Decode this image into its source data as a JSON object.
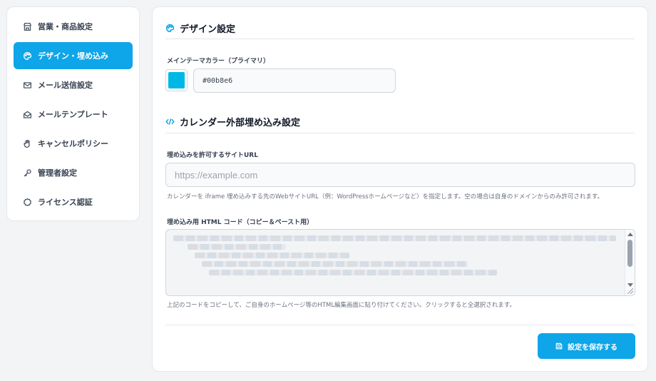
{
  "sidebar": {
    "items": [
      {
        "label": "営業・商品設定",
        "icon": "store-icon",
        "active": false
      },
      {
        "label": "デザイン・埋め込み",
        "icon": "palette-icon",
        "active": true
      },
      {
        "label": "メール送信設定",
        "icon": "mail-icon",
        "active": false
      },
      {
        "label": "メールテンプレート",
        "icon": "mail-open-icon",
        "active": false
      },
      {
        "label": "キャンセルポリシー",
        "icon": "hand-icon",
        "active": false
      },
      {
        "label": "管理者設定",
        "icon": "key-icon",
        "active": false
      },
      {
        "label": "ライセンス認証",
        "icon": "badge-icon",
        "active": false
      }
    ]
  },
  "design": {
    "title": "デザイン設定",
    "color_label": "メインテーマカラー（プライマリ）",
    "color_value": "#00b8e6"
  },
  "embed": {
    "title": "カレンダー外部埋め込み設定",
    "url_label": "埋め込みを許可するサイトURL",
    "url_placeholder": "https://example.com",
    "url_help": "カレンダーを iframe 埋め込みする先のWebサイトURL（例：WordPressホームページなど）を指定します。空の場合は自身のドメインからのみ許可されます。",
    "code_label": "埋め込み用 HTML コード（コピー＆ペースト用）",
    "code_help": "上記のコードをコピーして、ご自身のホームページ等のHTML編集画面に貼り付けてください。クリックすると全選択されます。"
  },
  "actions": {
    "save_label": "設定を保存する"
  },
  "colors": {
    "accent": "#0ea5e9",
    "swatch": "#00b8e6"
  }
}
